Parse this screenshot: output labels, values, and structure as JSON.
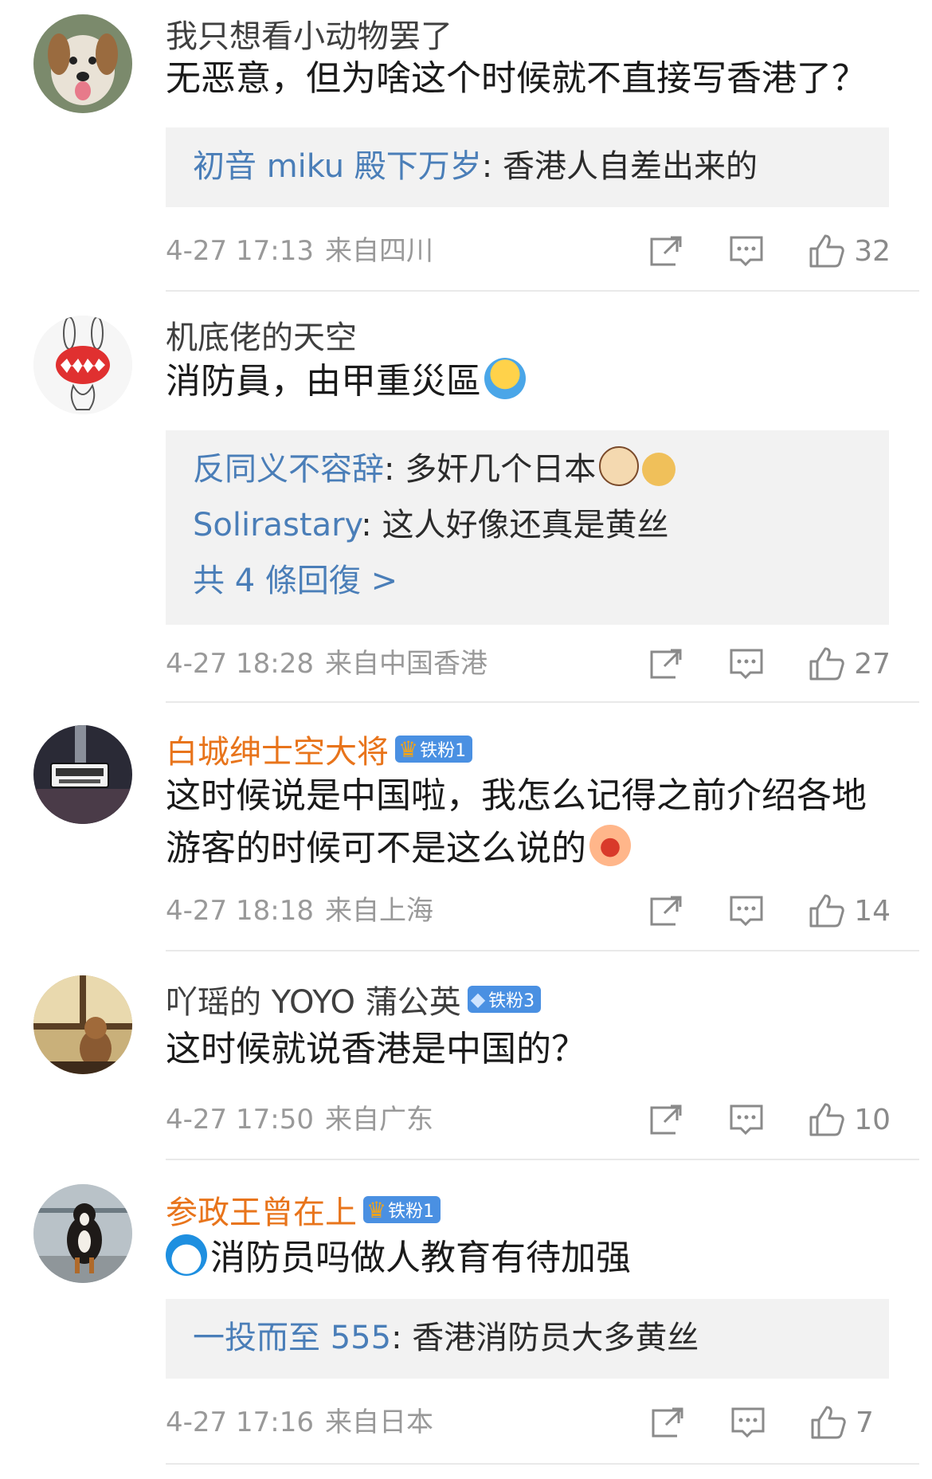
{
  "comments": [
    {
      "username": "我只想看小动物罢了",
      "username_color": "#3f3f3f",
      "text": "无恶意，但为啥这个时候就不直接写香港了？",
      "replies": [
        {
          "name": "初音 miku 殿下万岁",
          "sep": ": ",
          "text": "香港人自差出来的"
        }
      ],
      "time": "4-27 17:13",
      "location": "来自四川",
      "likes": "32"
    },
    {
      "username": "机底佬的天空",
      "text": "消防員，由甲重災區",
      "replies": [
        {
          "name": "反同义不容辞",
          "sep": ": ",
          "text": "多奸几个日本"
        },
        {
          "name": "Solirastary",
          "sep": ": ",
          "text": "这人好像还真是黄丝"
        }
      ],
      "more": "共 4 條回復 >",
      "time": "4-27 18:28",
      "location": "来自中国香港",
      "likes": "27"
    },
    {
      "username": "白城绅士空大将",
      "badge": "铁粉1",
      "text": "这时候说是中国啦，我怎么记得之前介绍各地游客的时候可不是这么说的",
      "time": "4-27 18:18",
      "location": "来自上海",
      "likes": "14"
    },
    {
      "username": "吖瑶的 YOYO 蒲公英",
      "badge": "铁粉3",
      "text": "这时候就说香港是中国的？",
      "time": "4-27 17:50",
      "location": "来自广东",
      "likes": "10"
    },
    {
      "username": "参政王曾在上",
      "badge": "铁粉1",
      "text": "消防员吗做人教育有待加强",
      "replies": [
        {
          "name": "一投而至 555",
          "sep": ": ",
          "text": "香港消防员大多黄丝"
        }
      ],
      "time": "4-27 17:16",
      "location": "来自日本",
      "likes": "7"
    }
  ],
  "icons": [
    "share-icon",
    "comment-icon",
    "like-icon"
  ],
  "colors": {
    "orange_name": "#e8741b",
    "link_blue": "#4a7eb8",
    "meta_gray": "#999999",
    "reply_bg": "#f2f2f2"
  }
}
